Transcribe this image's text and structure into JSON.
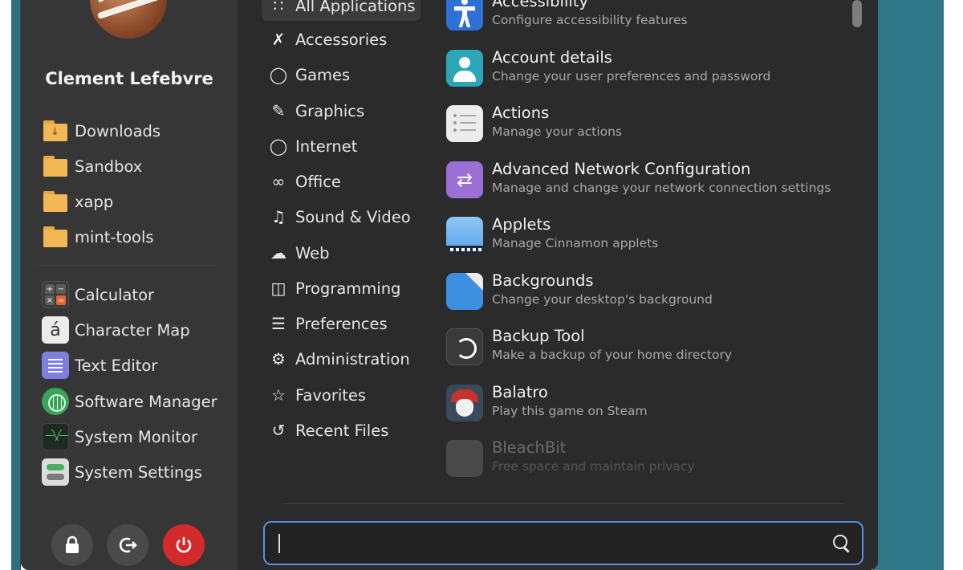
{
  "user": {
    "name": "Clement Lefebvre"
  },
  "places": [
    {
      "label": "Downloads",
      "icon": "folder-download-icon"
    },
    {
      "label": "Sandbox",
      "icon": "folder-icon"
    },
    {
      "label": "xapp",
      "icon": "folder-icon"
    },
    {
      "label": "mint-tools",
      "icon": "folder-icon"
    }
  ],
  "favorite_apps": [
    {
      "label": "Calculator",
      "icon": "calculator-icon"
    },
    {
      "label": "Character Map",
      "icon": "character-map-icon"
    },
    {
      "label": "Text Editor",
      "icon": "text-editor-icon"
    },
    {
      "label": "Software Manager",
      "icon": "software-manager-icon"
    },
    {
      "label": "System Monitor",
      "icon": "system-monitor-icon"
    },
    {
      "label": "System Settings",
      "icon": "system-settings-icon"
    }
  ],
  "session_buttons": {
    "lock": "lock-icon",
    "logout": "logout-icon",
    "power": "power-icon"
  },
  "categories": [
    {
      "label": "All Applications",
      "icon": "grid-icon",
      "active": true
    },
    {
      "label": "Accessories",
      "icon": "tools-icon"
    },
    {
      "label": "Games",
      "icon": "gamepad-icon"
    },
    {
      "label": "Graphics",
      "icon": "palette-icon"
    },
    {
      "label": "Internet",
      "icon": "globe-icon"
    },
    {
      "label": "Office",
      "icon": "paperclip-icon"
    },
    {
      "label": "Sound & Video",
      "icon": "film-icon"
    },
    {
      "label": "Web",
      "icon": "cloud-icon"
    },
    {
      "label": "Programming",
      "icon": "code-icon"
    },
    {
      "label": "Preferences",
      "icon": "sliders-icon"
    },
    {
      "label": "Administration",
      "icon": "gear-icon"
    },
    {
      "label": "Favorites",
      "icon": "star-icon"
    },
    {
      "label": "Recent Files",
      "icon": "history-icon"
    }
  ],
  "apps": [
    {
      "name": "Accessibility",
      "description": "Configure accessibility features"
    },
    {
      "name": "Account details",
      "description": "Change your user preferences and password"
    },
    {
      "name": "Actions",
      "description": "Manage your actions"
    },
    {
      "name": "Advanced Network Configuration",
      "description": "Manage and change your network connection settings"
    },
    {
      "name": "Applets",
      "description": "Manage Cinnamon applets"
    },
    {
      "name": "Backgrounds",
      "description": "Change your desktop's background"
    },
    {
      "name": "Backup Tool",
      "description": "Make a backup of your home directory"
    },
    {
      "name": "Balatro",
      "description": "Play this game on Steam"
    },
    {
      "name": "BleachBit",
      "description": "Free space and maintain privacy"
    }
  ],
  "search": {
    "value": "",
    "placeholder": ""
  },
  "colors": {
    "accent": "#5b8ee0",
    "power": "#d32b2b",
    "panel": "#2b2b2b",
    "sidebar": "#363636"
  }
}
